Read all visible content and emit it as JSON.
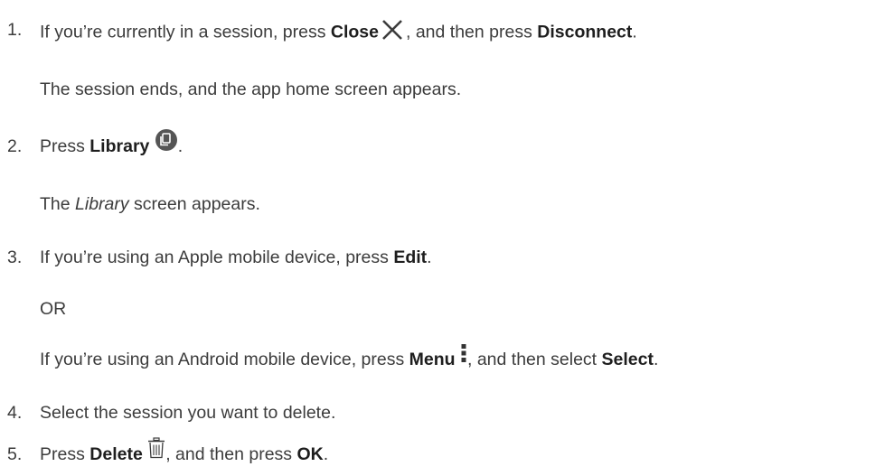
{
  "steps": [
    {
      "number": "1.",
      "pre": "If you’re currently in a session, press ",
      "bold1": "Close",
      "icon": "close-x-icon",
      "mid": ", and then press ",
      "bold2": "Disconnect",
      "post": ".",
      "result": "The session ends, and the app home screen appears."
    },
    {
      "number": "2.",
      "pre": "Press ",
      "bold1": "Library",
      "icon": "library-icon",
      "post": ".",
      "result_pre": "The ",
      "result_italic": "Library",
      "result_post": " screen appears."
    },
    {
      "number": "3.",
      "pre": "If you’re using an Apple mobile device, press ",
      "bold1": "Edit",
      "post": ".",
      "or": "OR",
      "alt_pre": "If you’re using an Android mobile device, press ",
      "alt_bold1": "Menu",
      "alt_icon": "vertical-dots-menu-icon",
      "alt_mid": ", and then select ",
      "alt_bold2": "Select",
      "alt_post": "."
    },
    {
      "number": "4.",
      "text": "Select the session you want to delete."
    },
    {
      "number": "5.",
      "pre": "Press ",
      "bold1": "Delete",
      "icon": "trash-icon",
      "mid": ", and then press ",
      "bold2": "OK",
      "post": "."
    }
  ]
}
